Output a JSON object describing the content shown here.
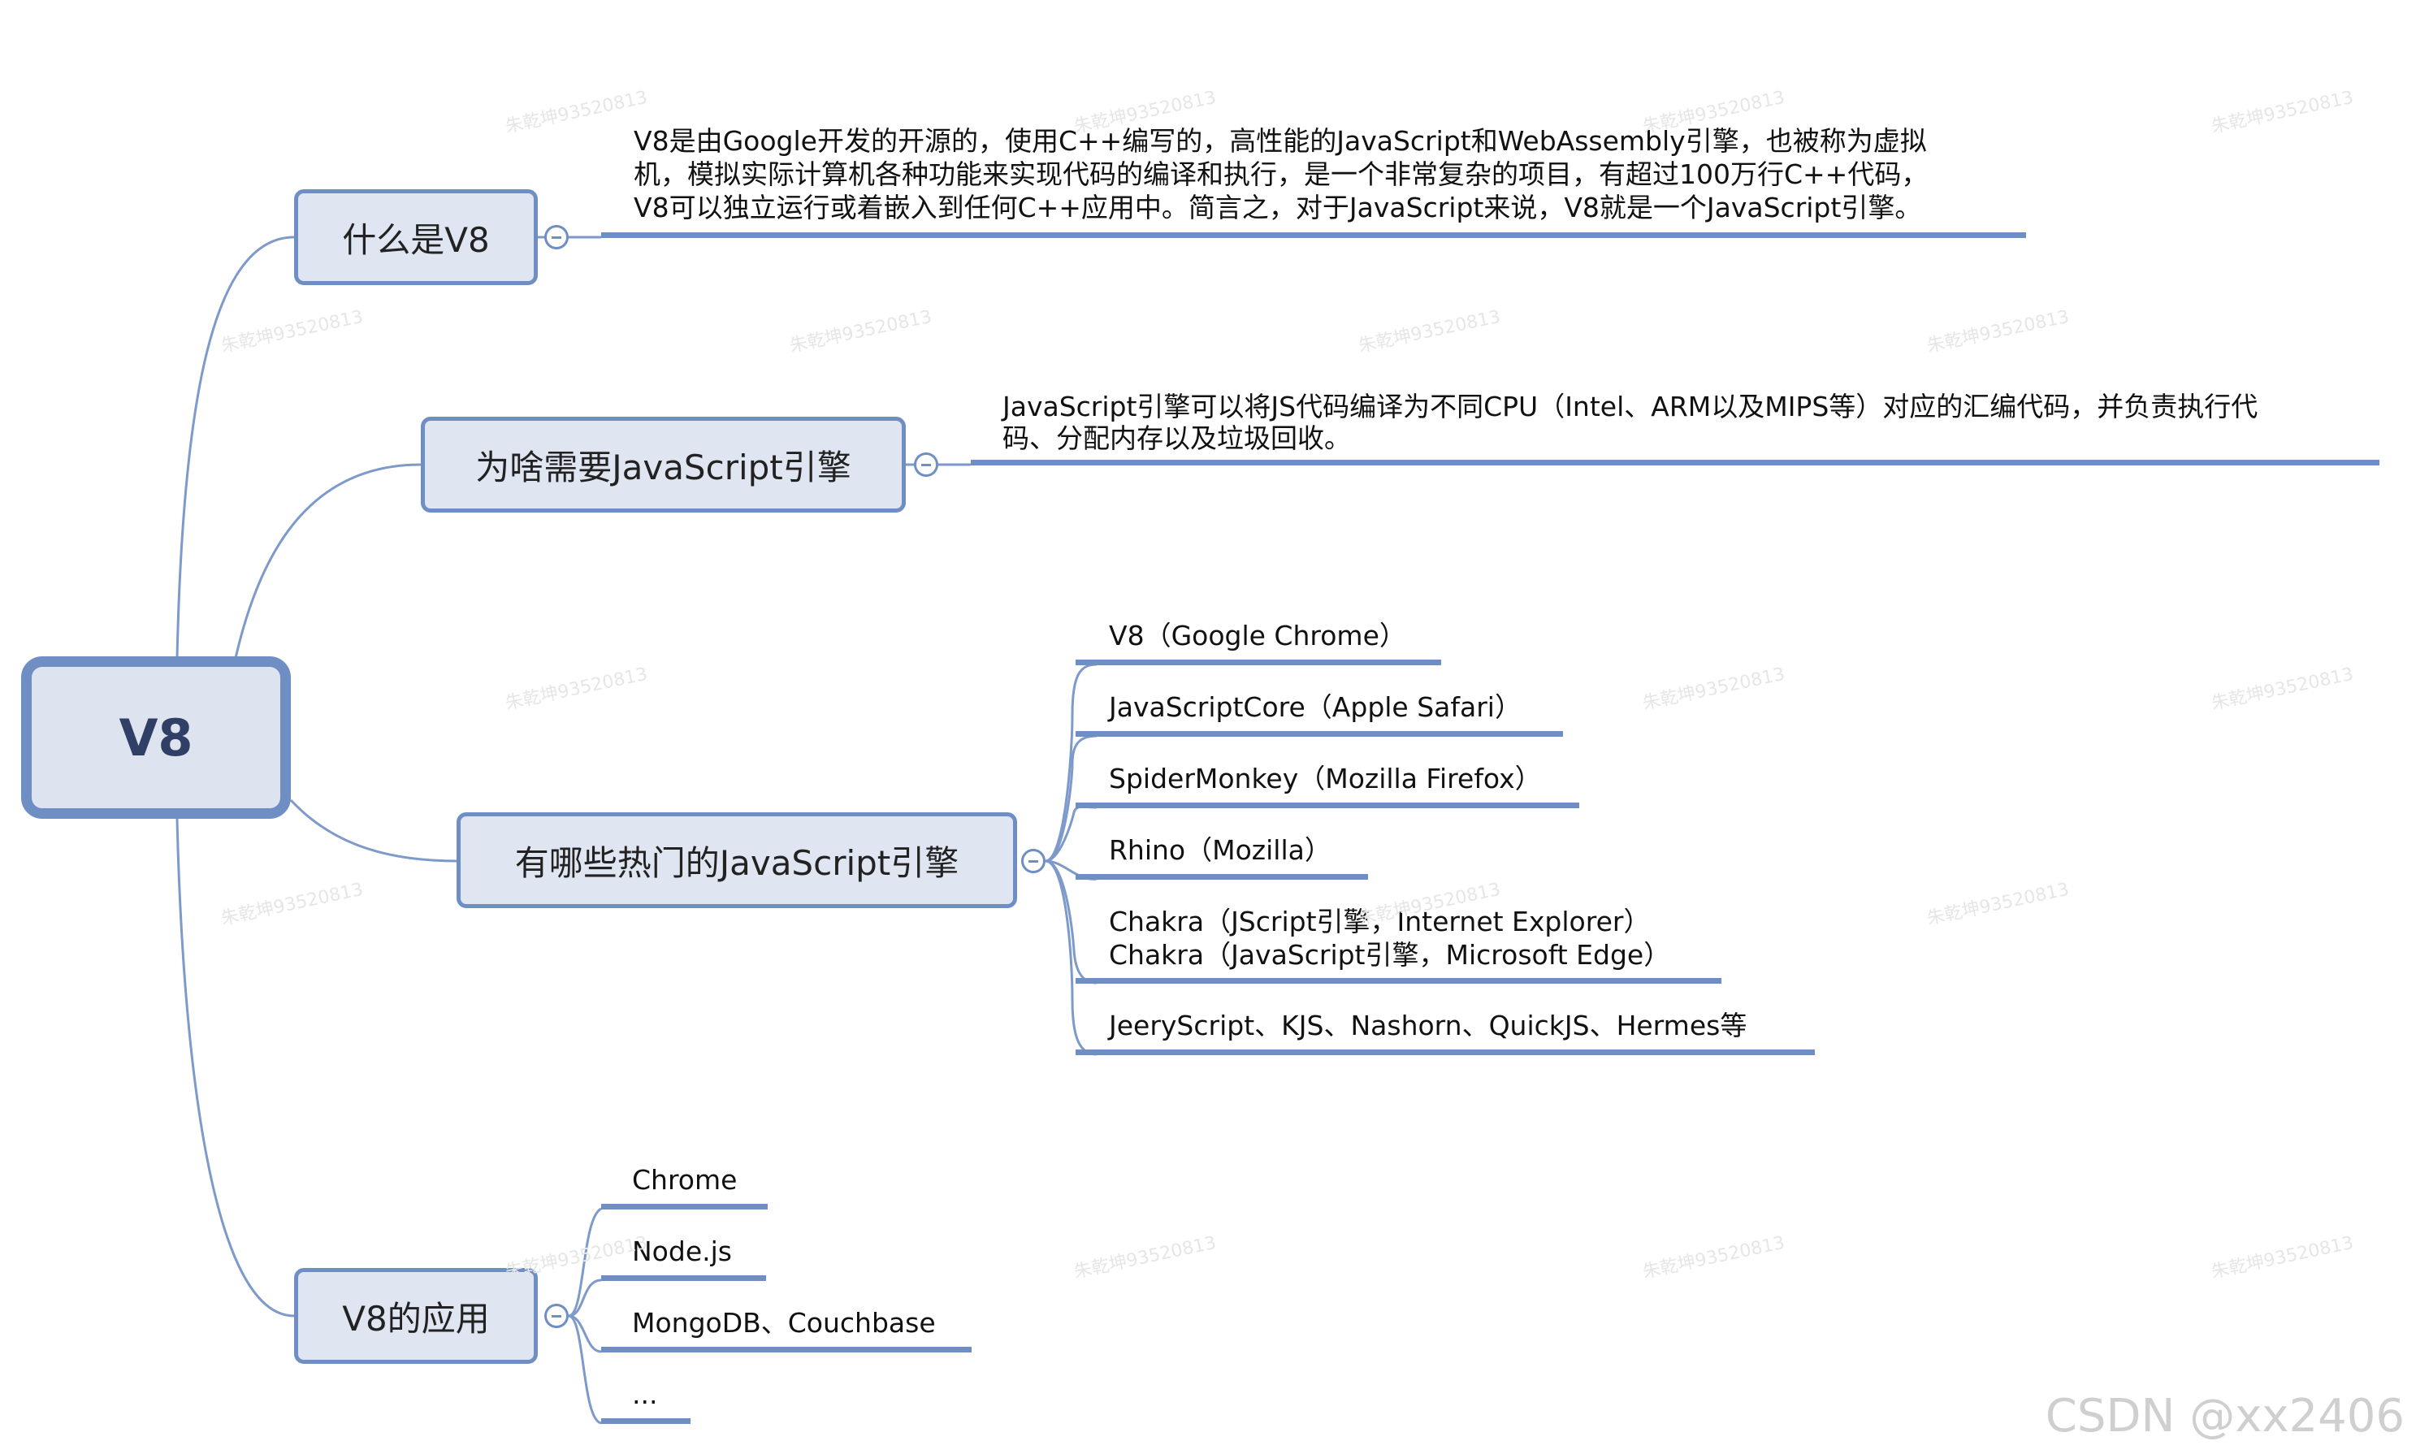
{
  "root": {
    "label": "V8"
  },
  "branches": [
    {
      "label": "什么是V8",
      "lines": [
        "V8是由Google开发的开源的，使用C++编写的，高性能的JavaScript和WebAssembly引擎，也被称为虚拟",
        "机，模拟实际计算机各种功能来实现代码的编译和执行，是一个非常复杂的项目，有超过100万行C++代码，",
        "V8可以独立运行或着嵌入到任何C++应用中。简言之，对于JavaScript来说，V8就是一个JavaScript引擎。"
      ]
    },
    {
      "label": "为啥需要JavaScript引擎",
      "lines": [
        "JavaScript引擎可以将JS代码编译为不同CPU（Intel、ARM以及MIPS等）对应的汇编代码，并负责执行代",
        "码、分配内存以及垃圾回收。"
      ]
    },
    {
      "label": "有哪些热门的JavaScript引擎",
      "items": [
        [
          "V8（Google Chrome）"
        ],
        [
          "JavaScriptCore（Apple Safari）"
        ],
        [
          "SpiderMonkey（Mozilla Firefox）"
        ],
        [
          "Rhino（Mozilla）"
        ],
        [
          "Chakra（JScript引擎，Internet Explorer）",
          "Chakra（JavaScript引擎，Microsoft Edge）"
        ],
        [
          "JeeryScript、KJS、Nashorn、QuickJS、Hermes等"
        ]
      ]
    },
    {
      "label": "V8的应用",
      "items": [
        [
          "Chrome"
        ],
        [
          "Node.js"
        ],
        [
          "MongoDB、Couchbase"
        ],
        [
          "..."
        ]
      ]
    }
  ],
  "watermark": "朱乾坤93520813",
  "credit": "CSDN @xx2406",
  "colors": {
    "accent": "#6f8ec4",
    "node_fill": "#dfe5f1",
    "root_text": "#2f3f66"
  }
}
